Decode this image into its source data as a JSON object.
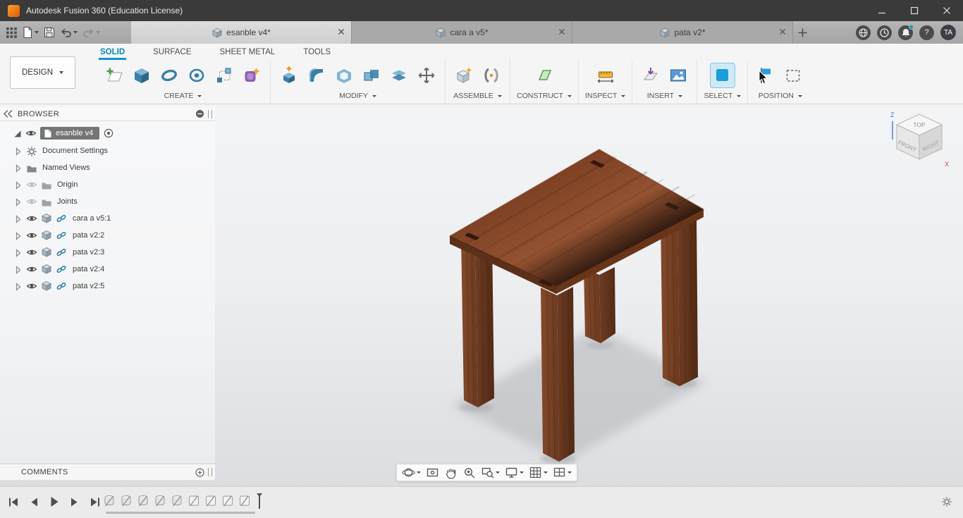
{
  "titlebar": {
    "title": "Autodesk Fusion 360 (Education License)"
  },
  "tabstrip": {
    "tabs": [
      {
        "label": "esanble v4*"
      },
      {
        "label": "cara a v5*"
      },
      {
        "label": "pata v2*"
      }
    ],
    "help_glyph": "?",
    "avatar_initials": "TA"
  },
  "ribbon": {
    "workspace": "DESIGN",
    "tabs": [
      {
        "label": "SOLID"
      },
      {
        "label": "SURFACE"
      },
      {
        "label": "SHEET METAL"
      },
      {
        "label": "TOOLS"
      }
    ],
    "groups": [
      {
        "label": "CREATE"
      },
      {
        "label": "MODIFY"
      },
      {
        "label": "ASSEMBLE"
      },
      {
        "label": "CONSTRUCT"
      },
      {
        "label": "INSPECT"
      },
      {
        "label": "INSERT"
      },
      {
        "label": "SELECT"
      },
      {
        "label": "POSITION"
      }
    ]
  },
  "browser": {
    "header": "BROWSER",
    "root": {
      "label": "esanble v4"
    },
    "items": [
      {
        "label": "Document Settings"
      },
      {
        "label": "Named Views"
      },
      {
        "label": "Origin"
      },
      {
        "label": "Joints"
      },
      {
        "label": "cara a v5:1"
      },
      {
        "label": "pata v2:2"
      },
      {
        "label": "pata v2:3"
      },
      {
        "label": "pata v2:4"
      },
      {
        "label": "pata v2:5"
      }
    ]
  },
  "comments": {
    "header": "COMMENTS"
  },
  "viewport": {
    "viewcube": {
      "top": "TOP",
      "front": "FRONT",
      "right": "RIGHT",
      "axis_z": "Z",
      "axis_x": "X"
    }
  },
  "colors": {
    "accent": "#0696d7",
    "wood_top": "#8a4a2c",
    "wood_dark": "#5a2f19"
  }
}
